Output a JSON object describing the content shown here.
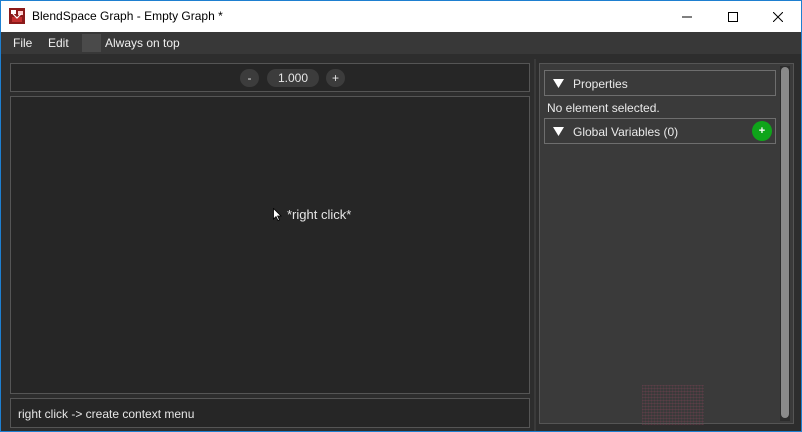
{
  "window": {
    "title": "BlendSpace Graph - Empty Graph *",
    "controls": {
      "minimize": "minimize-icon",
      "maximize": "maximize-icon",
      "close": "close-icon"
    }
  },
  "menu": {
    "file_label": "File",
    "edit_label": "Edit",
    "always_on_top_label": "Always on top",
    "always_on_top_checked": false
  },
  "zoom": {
    "minus_label": "-",
    "value": "1.000",
    "plus_label": "+"
  },
  "canvas": {
    "hint": "*right click*"
  },
  "status": {
    "text": "right click -> create context menu"
  },
  "inspector": {
    "properties_label": "Properties",
    "no_selection_text": "No element selected.",
    "globals_label": "Global Variables  (0)",
    "add_label": "+"
  },
  "colors": {
    "accent": "#1e7fd0",
    "add_button": "#0fa51a",
    "panel_bg": "#3a3a3a",
    "canvas_bg": "#262626"
  }
}
